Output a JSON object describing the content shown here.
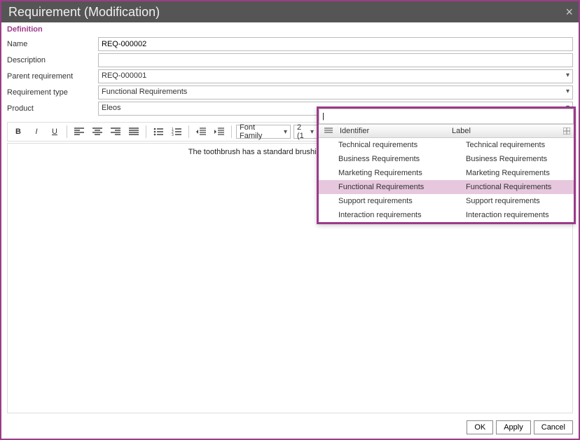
{
  "title": "Requirement (Modification)",
  "section": "Definition",
  "labels": {
    "name": "Name",
    "description": "Description",
    "parent": "Parent requirement",
    "reqtype": "Requirement type",
    "product": "Product"
  },
  "fields": {
    "name": "REQ-000002",
    "description": "",
    "parent": "REQ-000001",
    "reqtype": "Functional Requirements",
    "product": "Eleos"
  },
  "toolbar": {
    "font_family": "Font Family",
    "font_size": "2 (1"
  },
  "editor_text": "The toothbrush has a standard brushing mode: this mode is",
  "popup": {
    "search": "|",
    "col_identifier": "Identifier",
    "col_label": "Label",
    "rows": [
      {
        "id": "Technical requirements",
        "label": "Technical requirements",
        "selected": false
      },
      {
        "id": "Business Requirements",
        "label": "Business Requirements",
        "selected": false
      },
      {
        "id": "Marketing Requirements",
        "label": "Marketing Requirements",
        "selected": false
      },
      {
        "id": "Functional Requirements",
        "label": "Functional Requirements",
        "selected": true
      },
      {
        "id": "Support requirements",
        "label": "Support requirements",
        "selected": false
      },
      {
        "id": "Interaction requirements",
        "label": "Interaction requirements",
        "selected": false
      }
    ]
  },
  "buttons": {
    "ok": "OK",
    "apply": "Apply",
    "cancel": "Cancel"
  }
}
